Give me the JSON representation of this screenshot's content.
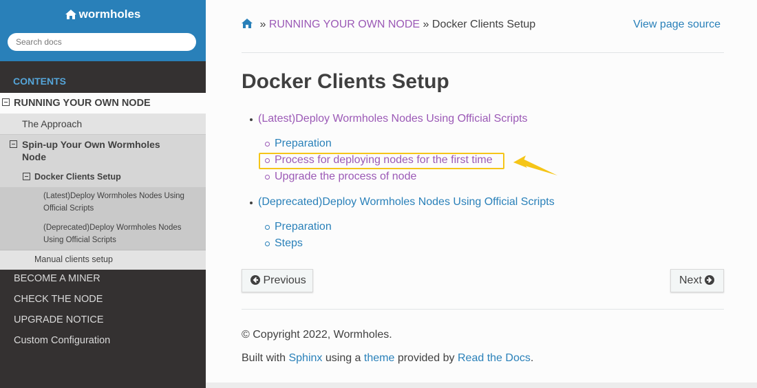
{
  "sidebar": {
    "project_name": "wormholes",
    "search_placeholder": "Search docs",
    "caption": "CONTENTS",
    "current_section": "RUNNING YOUR OWN NODE",
    "approach": "The Approach",
    "spin_up": "Spin-up Your Own Wormholes Node",
    "docker_setup": "Docker Clients Setup",
    "latest_item": "(Latest)Deploy Wormholes Nodes Using Official Scripts",
    "deprecated_item": "(Deprecated)Deploy Wormholes Nodes Using Official Scripts",
    "manual_setup": "Manual clients setup",
    "top_items": [
      "BECOME A MINER",
      "CHECK THE NODE",
      "UPGRADE NOTICE",
      "Custom Configuration"
    ]
  },
  "breadcrumb": {
    "separator1": "»",
    "parent": "RUNNING YOUR OWN NODE",
    "separator2": "»",
    "current": "Docker Clients Setup",
    "view_source": "View page source"
  },
  "page": {
    "title": "Docker Clients Setup",
    "toc": [
      {
        "label": "(Latest)Deploy Wormholes Nodes Using Official Scripts",
        "children": [
          "Preparation",
          "Process for deploying nodes for the first time",
          "Upgrade the process of node"
        ]
      },
      {
        "label": "(Deprecated)Deploy Wormholes Nodes Using Official Scripts",
        "children": [
          "Preparation",
          "Steps"
        ]
      }
    ]
  },
  "nav_buttons": {
    "previous": "Previous",
    "next": "Next"
  },
  "footer": {
    "copyright": "© Copyright 2022, Wormholes.",
    "built_with": "Built with",
    "sphinx": "Sphinx",
    "using_a": "using a",
    "theme": "theme",
    "provided_by": "provided by",
    "rtd": "Read the Docs",
    "period": "."
  },
  "colors": {
    "sidebar_bg": "#343131",
    "header_blue": "#2980b9",
    "link_purple": "#9b59b6",
    "highlight_yellow": "#f5c518"
  }
}
